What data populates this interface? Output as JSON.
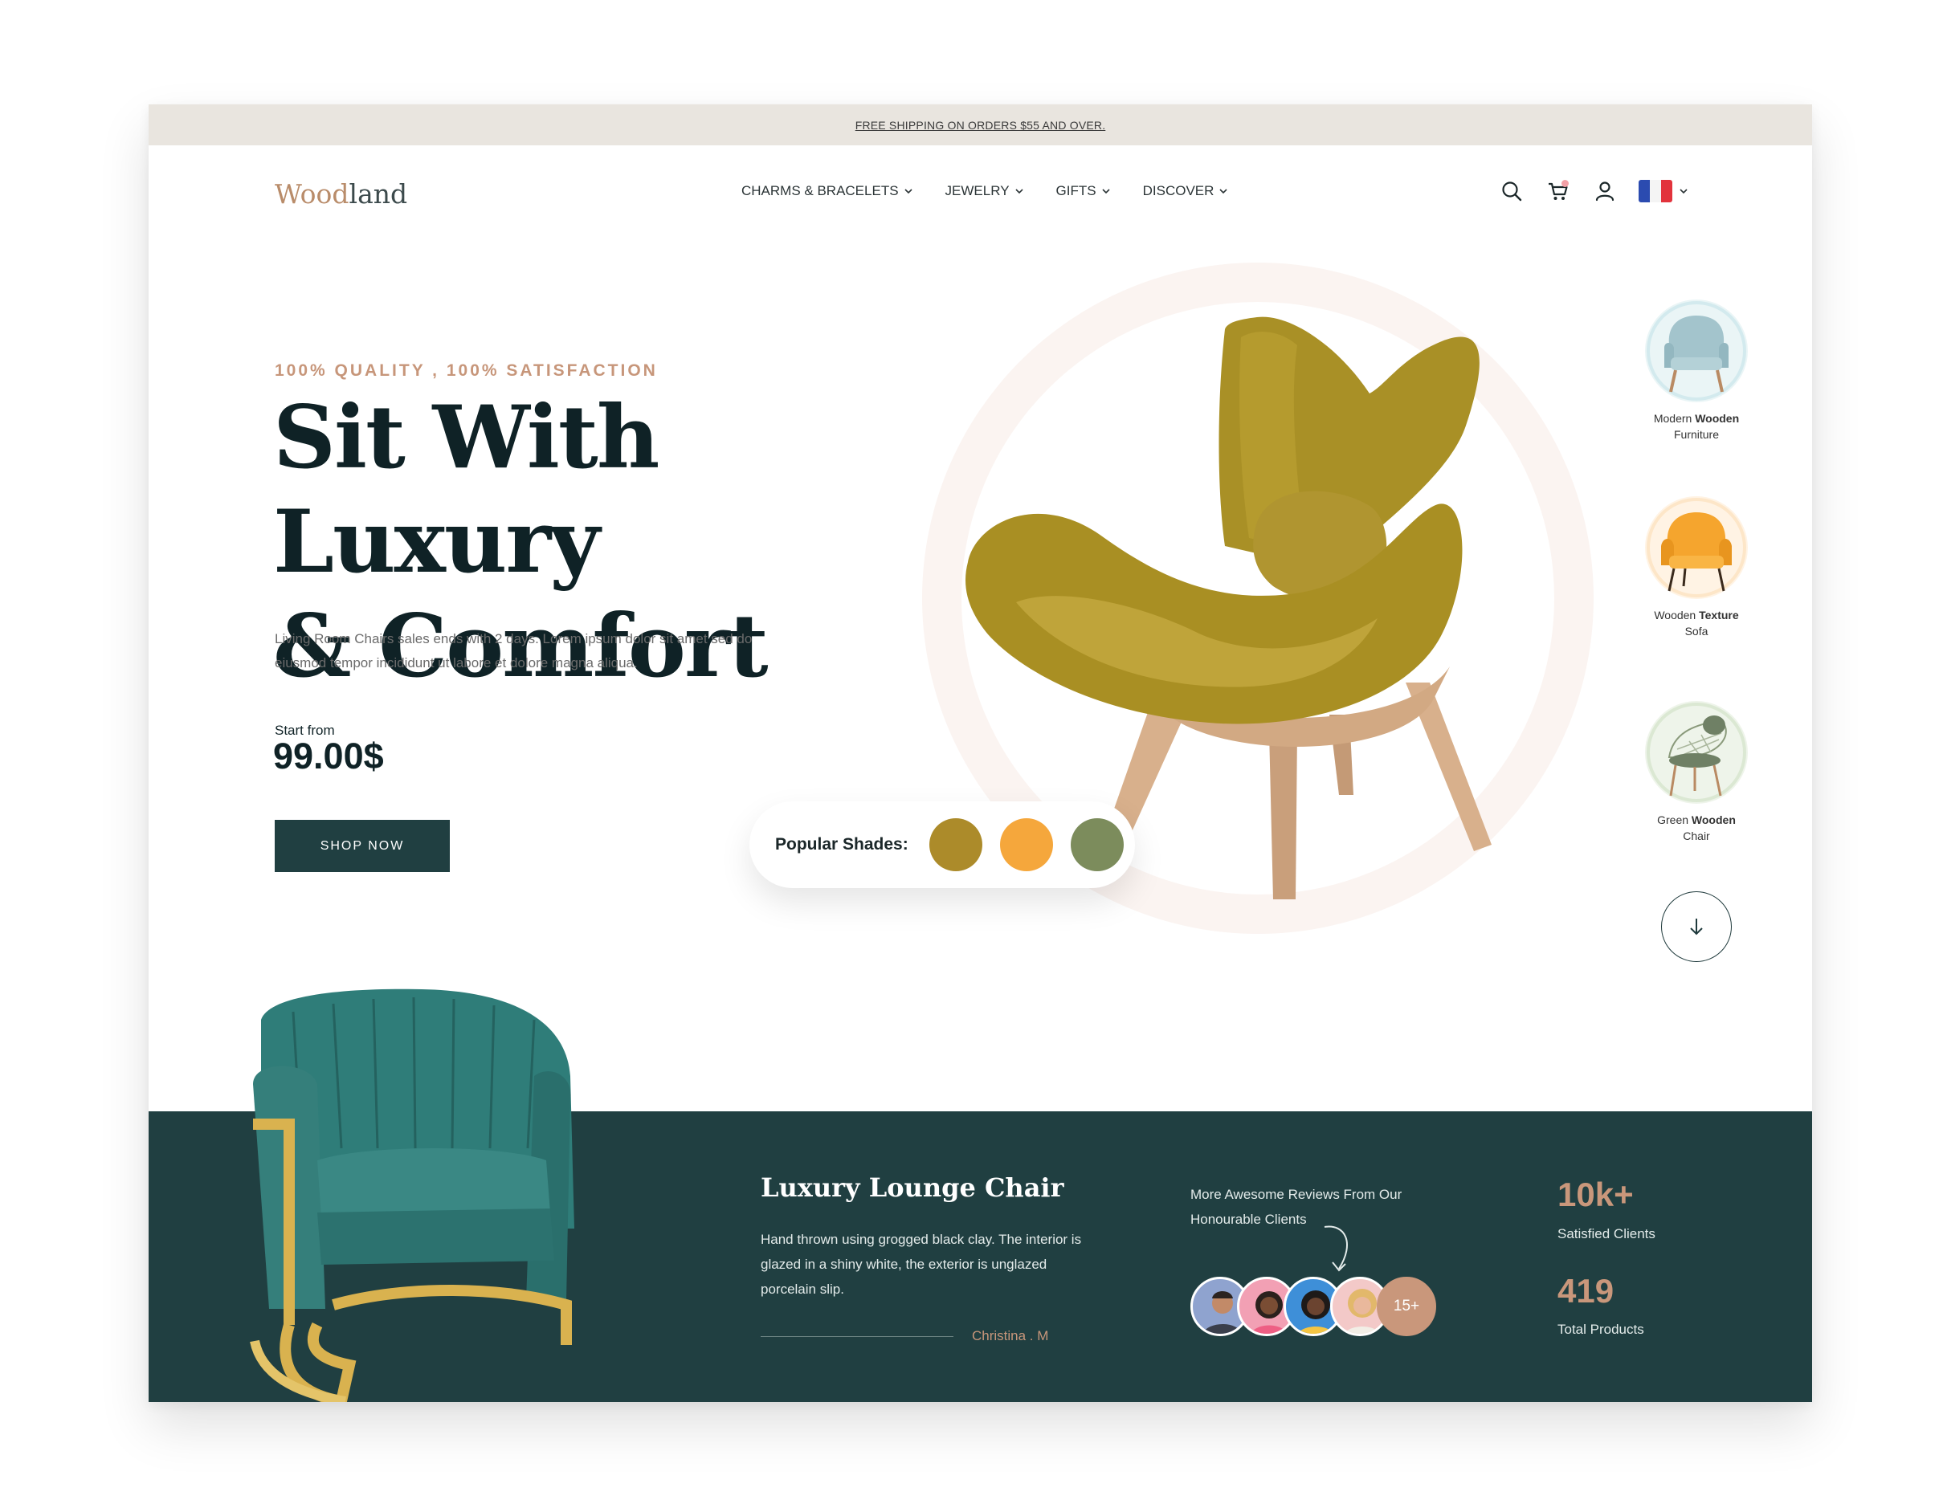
{
  "announcement": "FREE SHIPPING ON ORDERS $55 AND OVER.",
  "logo": {
    "part1": "Wood",
    "part2": "land"
  },
  "nav": [
    {
      "label": "CHARMS & BRACELETS"
    },
    {
      "label": "JEWELRY"
    },
    {
      "label": "GIFTS"
    },
    {
      "label": "DISCOVER"
    }
  ],
  "header_icons": [
    "search-icon",
    "cart-icon",
    "user-icon",
    "flag-france-icon",
    "chevron-down-icon"
  ],
  "hero": {
    "eyebrow": "100% QUALITY , 100% SATISFACTION",
    "headline_line1": "Sit With Luxury",
    "headline_line2": "& Comfort",
    "description": "Living Room Chairs sales ends with 2 days. Lorem ipsum dolor sit amet sed do eiusmod tempor incididunt ut labore et dolore magna aliqua.",
    "start_label": "Start from",
    "price": "99.00$",
    "cta": "SHOP NOW"
  },
  "shades": {
    "label": "Popular Shades:",
    "colors": [
      "#ac8b2a",
      "#f5a73c",
      "#7c8c5c"
    ]
  },
  "categories": [
    {
      "name_plain": "Modern ",
      "name_bold": "Wooden",
      "name_line2": "Furniture",
      "color": "#a9c8cf"
    },
    {
      "name_plain": "Wooden ",
      "name_bold": "Texture",
      "name_line2": "Sofa",
      "color": "#f3a63a"
    },
    {
      "name_plain": "Green ",
      "name_bold": "Wooden",
      "name_line2": "Chair",
      "color": "#6f8065"
    }
  ],
  "featured": {
    "title": "Luxury Lounge Chair",
    "description": "Hand thrown using grogged black clay. The interior is glazed in a shiny white, the exterior is unglazed porcelain slip.",
    "author": "Christina . M"
  },
  "reviews": {
    "text": "More Awesome Reviews From Our Honourable Clients",
    "more": "15+"
  },
  "stats": [
    {
      "value": "10k+",
      "label": "Satisfied Clients"
    },
    {
      "value": "419",
      "label": "Total Products"
    }
  ],
  "colors": {
    "dark_teal": "#203f41",
    "accent": "#c9977b",
    "topbar": "#e9e5df"
  }
}
